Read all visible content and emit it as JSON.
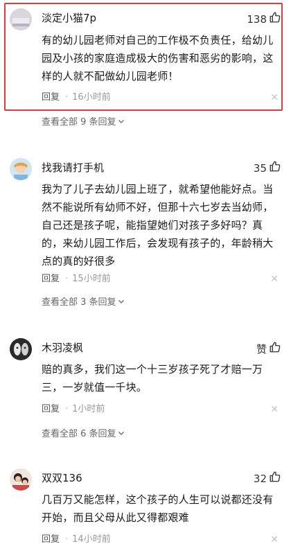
{
  "comments": [
    {
      "username": "淡定小猫7p",
      "likes": "138",
      "text": "有的幼儿园老师对自己的工作极不负责任，给幼儿园及小孩的家庭造成极大的伤害和恶劣的影响，这样的人就不配做幼儿园老师！",
      "reply_label": "回复",
      "time": "16小时前",
      "see_all": "查看全部 9 条回复"
    },
    {
      "username": "找我请打手机",
      "likes": "35",
      "text": "我为了儿子去幼儿园上班了，就希望他能好点。当然不能说所有幼师不好，但那十六七岁去当幼师，自己还是孩子呢，能指望她们对孩子多好吗？真的，来幼儿园工作后，会发现有孩子的，年龄稍大点的真的好很多",
      "reply_label": "回复",
      "time": "15小时前",
      "see_all": "查看全部 3 条回复"
    },
    {
      "username": "木羽凌枫",
      "likes": "赞",
      "text": "赔的真多，我们这一个十三岁孩子死了才赔一万三，一岁就值一千块。",
      "reply_label": "回复",
      "time": "1小时前",
      "see_all": "查看全部 6 条回复"
    },
    {
      "username": "双双136",
      "likes": "32",
      "text": "几百万又能怎样，这个孩子的人生可以说都还没有开始，而且父母从此又得都艰难",
      "reply_label": "回复",
      "time": "14小时前"
    }
  ],
  "colors": {
    "highlight_border": "#e4393c",
    "meta_text": "#9a9a9a"
  },
  "icons": {
    "like": "thumbs-up-icon",
    "dismiss": "close-icon",
    "expand": "chevron-down-icon",
    "dot": "·",
    "close_glyph": "✕"
  }
}
